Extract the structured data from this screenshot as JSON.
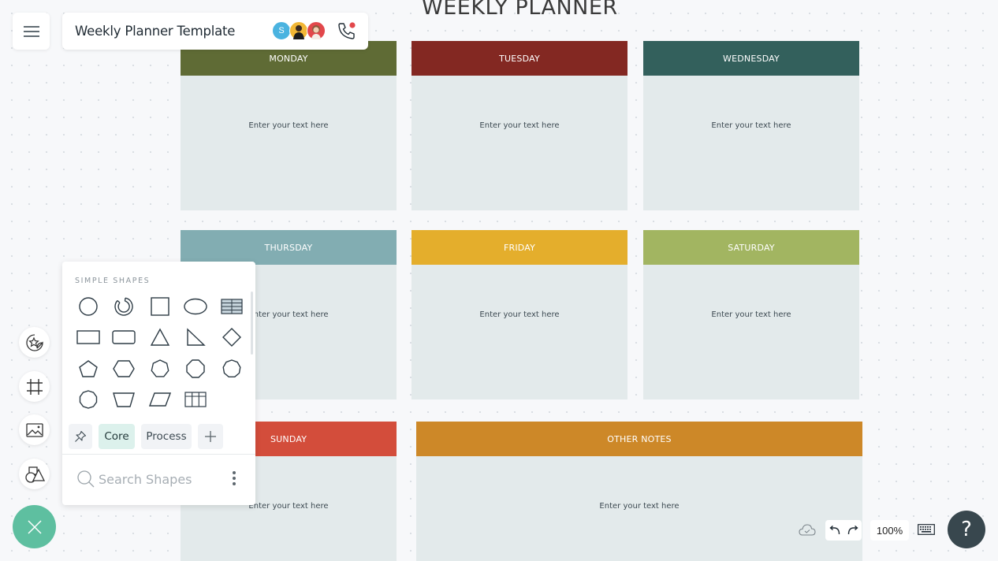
{
  "header": {
    "menu_icon": "hamburger-icon",
    "document_title": "Weekly Planner Template",
    "collaborators": [
      {
        "initial": "S",
        "color": "#4ab3e0"
      },
      {
        "initial": "",
        "color": "#f2b735"
      },
      {
        "initial": "",
        "color": "#e2474b"
      }
    ],
    "call_icon": "phone-icon",
    "call_indicator_color": "#e2474b"
  },
  "board": {
    "title": "WEEKLY PLANNER",
    "placeholder_text": "Enter your text here",
    "cards": [
      {
        "id": "monday",
        "label": "MONDAY",
        "color": "#5f6b35",
        "body": "Enter your text here"
      },
      {
        "id": "tuesday",
        "label": "TUESDAY",
        "color": "#832822",
        "body": "Enter your text here"
      },
      {
        "id": "wednesday",
        "label": "WEDNESDAY",
        "color": "#33605c",
        "body": "Enter your text here"
      },
      {
        "id": "thursday",
        "label": "THURSDAY",
        "color": "#82adb2",
        "body": "Enter your text here"
      },
      {
        "id": "friday",
        "label": "FRIDAY",
        "color": "#e4ae2c",
        "body": "Enter your text here"
      },
      {
        "id": "saturday",
        "label": "SATURDAY",
        "color": "#a2b561",
        "body": "Enter your text here"
      },
      {
        "id": "sunday",
        "label": "SUNDAY",
        "color": "#d34d3b",
        "body": "Enter your text here"
      },
      {
        "id": "other-notes",
        "label": "OTHER NOTES",
        "color": "#cd8828",
        "body": "Enter your text here"
      }
    ]
  },
  "left_toolbar": {
    "tools": [
      "sticker-star-icon",
      "frame-icon",
      "image-icon",
      "shapes-icon"
    ],
    "fab_icon": "close-icon",
    "fab_color": "#5ebfa0"
  },
  "shapes_panel": {
    "section_label": "SIMPLE SHAPES",
    "shapes": [
      "circle",
      "ring",
      "square",
      "ellipse",
      "table-striped",
      "rectangle",
      "rounded-rectangle",
      "triangle",
      "right-triangle",
      "diamond",
      "pentagon",
      "hexagon",
      "heptagon",
      "octagon",
      "nonagon",
      "decagon",
      "trapezoid",
      "parallelogram",
      "table-grid"
    ],
    "tabs": [
      {
        "label": "",
        "icon": "pin-icon",
        "active": false
      },
      {
        "label": "Core",
        "active": true
      },
      {
        "label": "Process",
        "active": false
      },
      {
        "label": "",
        "icon": "plus-icon",
        "active": false
      }
    ],
    "search_placeholder": "Search Shapes",
    "more_icon": "kebab-menu-icon"
  },
  "bottom_bar": {
    "sync_icon": "cloud-check-icon",
    "undo_icon": "undo-icon",
    "redo_icon": "redo-icon",
    "zoom_level": "100%",
    "keyboard_icon": "keyboard-icon",
    "help_label": "?"
  }
}
